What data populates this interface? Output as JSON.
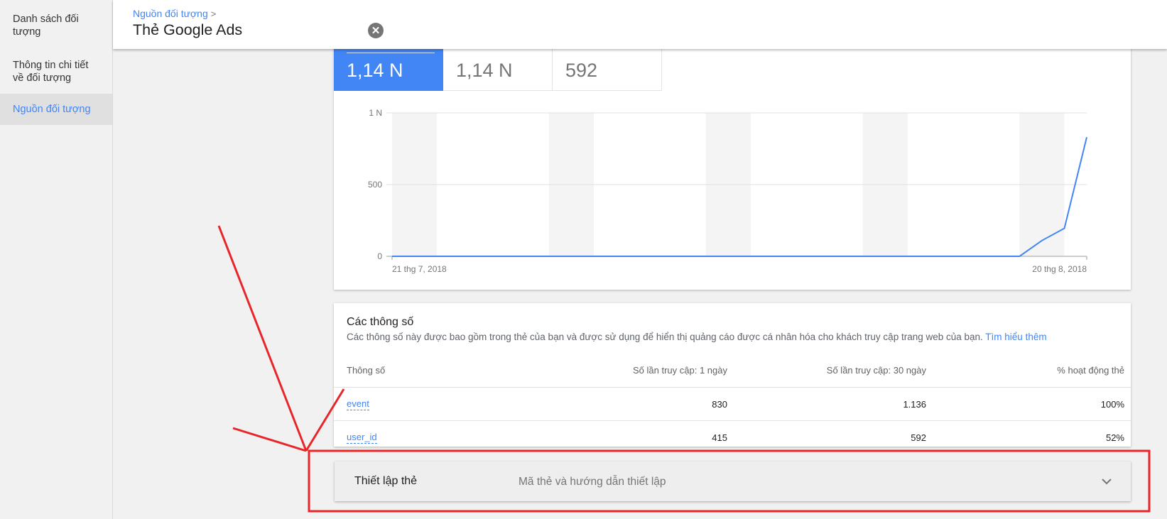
{
  "sidebar": {
    "items": [
      {
        "label": "Danh sách đối tượng"
      },
      {
        "label": "Thông tin chi tiết về đối tượng"
      },
      {
        "label": "Nguồn đối tượng"
      }
    ]
  },
  "header": {
    "breadcrumb": "Nguồn đối tượng",
    "title": "Thẻ Google Ads"
  },
  "tiles": [
    {
      "value": "1,14 N"
    },
    {
      "value": "1,14 N"
    },
    {
      "value": "592"
    }
  ],
  "chart_data": {
    "type": "line",
    "series": [
      {
        "values": [
          0,
          0,
          0,
          0,
          0,
          0,
          0,
          0,
          0,
          0,
          0,
          0,
          0,
          0,
          0,
          0,
          0,
          0,
          0,
          0,
          0,
          0,
          0,
          0,
          0,
          0,
          0,
          0,
          0,
          110,
          195,
          830
        ]
      }
    ],
    "x_labels": [
      "21 thg 7, 2018",
      "20 thg 8, 2018"
    ],
    "y_ticks": [
      "0",
      "500",
      "1 N"
    ],
    "ylim": [
      0,
      1000
    ],
    "grid": true,
    "colors": {
      "line": "#4285f4",
      "shade": "#f4f4f4"
    }
  },
  "params": {
    "title": "Các thông số",
    "description": "Các thông số này được bao gồm trong thẻ của bạn và được sử dụng để hiển thị quảng cáo được cá nhân hóa cho khách truy cập trang web của bạn.",
    "link": "Tìm hiểu thêm",
    "columns": [
      "Thông số",
      "Số lần truy cập: 1 ngày",
      "Số lần truy cập: 30 ngày",
      "% hoạt động thẻ"
    ],
    "rows": [
      {
        "name": "event",
        "day1": "830",
        "day30": "1.136",
        "pct": "100%"
      },
      {
        "name": "user_id",
        "day1": "415",
        "day30": "592",
        "pct": "52%"
      }
    ]
  },
  "setup": {
    "title": "Thiết lập thẻ",
    "description": "Mã thẻ và hướng dẫn thiết lập"
  },
  "annotation": {
    "color": "#e8262a"
  }
}
